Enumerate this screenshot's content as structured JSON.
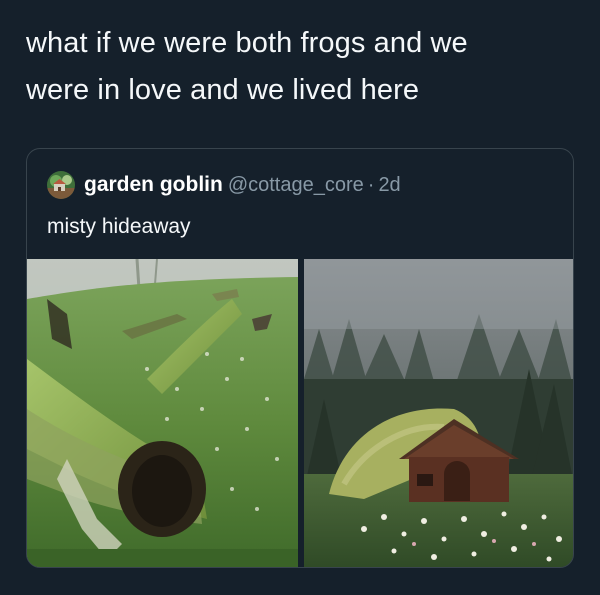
{
  "post": {
    "text_line1": "what if we were both frogs and we",
    "text_line2": "were in love and we lived here"
  },
  "quoted_tweet": {
    "display_name": "garden goblin",
    "handle": "@cottage_core",
    "separator": "·",
    "time": "2d",
    "text": "misty hideaway"
  },
  "media": [
    {
      "name": "mossy-fallen-log-photo"
    },
    {
      "name": "misty-forest-cabin-photo"
    }
  ],
  "colors": {
    "background": "#15202b",
    "border": "#38444d",
    "secondary_text": "#8899a6"
  }
}
